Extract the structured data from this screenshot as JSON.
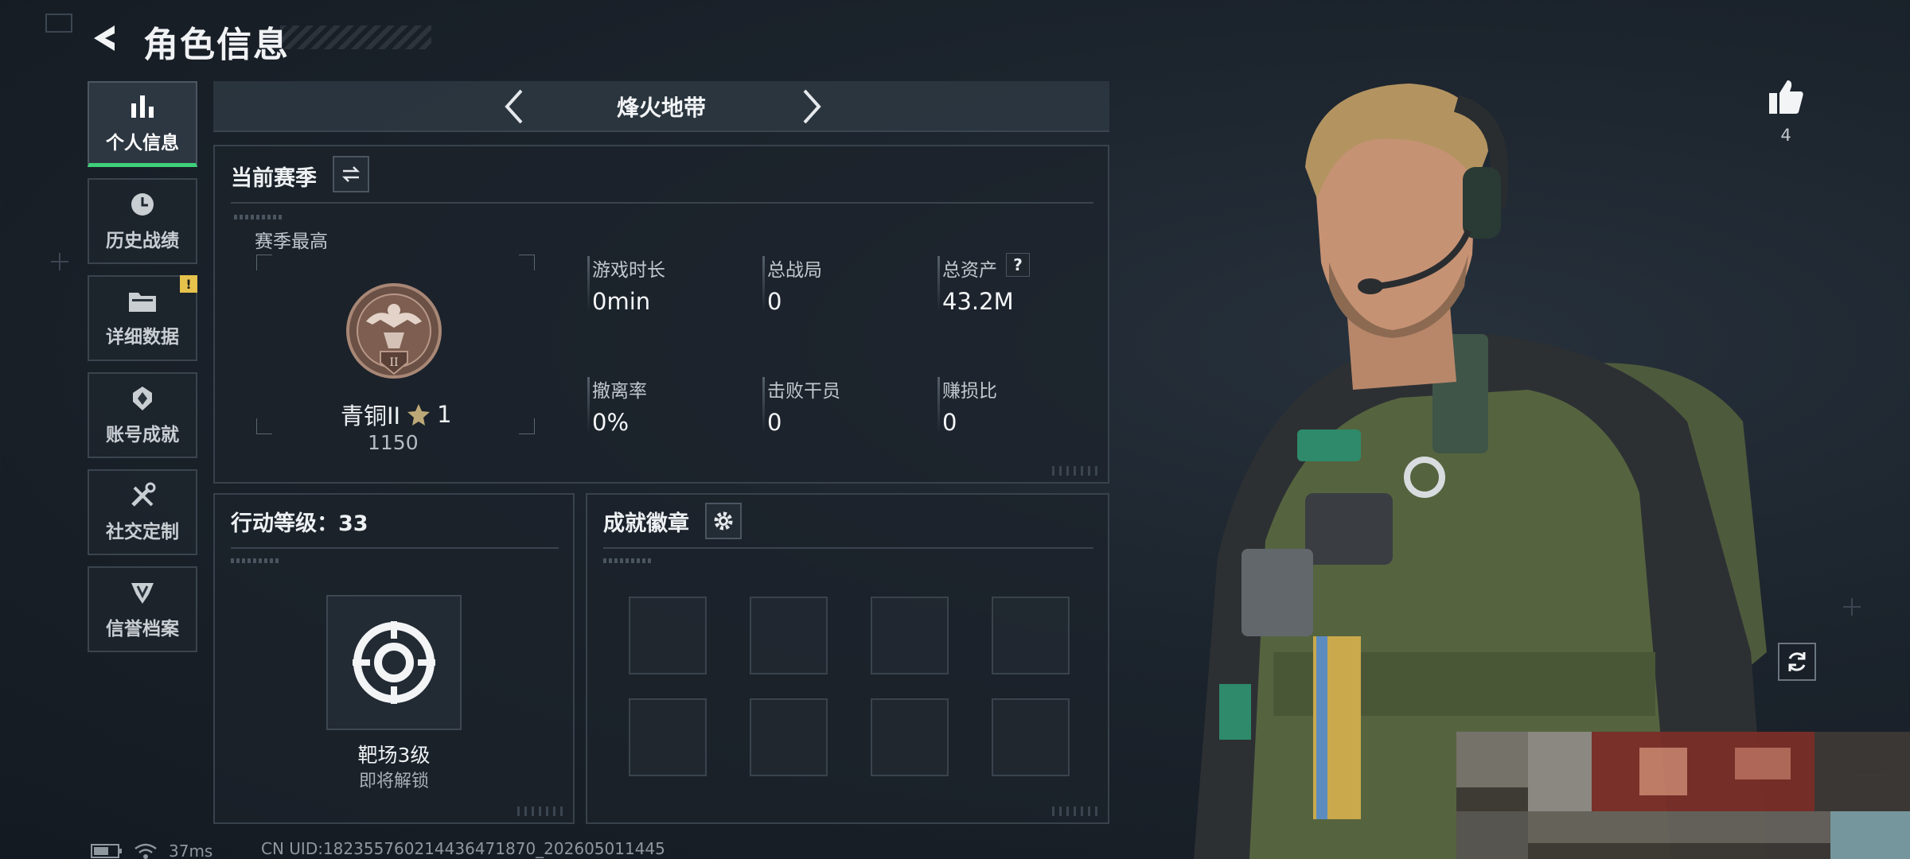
{
  "header": {
    "title": "角色信息"
  },
  "sidebar": {
    "items": [
      {
        "label": "个人信息",
        "icon": "bar-chart-icon",
        "active": true
      },
      {
        "label": "历史战绩",
        "icon": "history-clock-icon",
        "active": false
      },
      {
        "label": "详细数据",
        "icon": "folder-icon",
        "active": false,
        "badge": "!"
      },
      {
        "label": "账号成就",
        "icon": "achievement-icon",
        "active": false
      },
      {
        "label": "社交定制",
        "icon": "tools-icon",
        "active": false
      },
      {
        "label": "信誉档案",
        "icon": "reputation-icon",
        "active": false
      }
    ]
  },
  "mode": {
    "title": "烽火地带"
  },
  "season": {
    "title": "当前赛季",
    "best_label": "赛季最高",
    "rank_name": "青铜II",
    "rank_stars": "1",
    "rank_score": "1150",
    "stats": [
      {
        "label": "游戏时长",
        "value": "0min"
      },
      {
        "label": "总战局",
        "value": "0"
      },
      {
        "label": "总资产",
        "value": "43.2M",
        "help": "?"
      },
      {
        "label": "撤离率",
        "value": "0%"
      },
      {
        "label": "击败干员",
        "value": "0"
      },
      {
        "label": "赚损比",
        "value": "0"
      }
    ]
  },
  "action_level": {
    "title": "行动等级：33",
    "item_name": "靶场3级",
    "item_status": "即将解锁"
  },
  "achievements": {
    "title": "成就徽章",
    "slots": 8
  },
  "right": {
    "like_count": "4"
  },
  "footer": {
    "ping": "37ms",
    "uid": "CN UID:18235576021443647187​0_202605011445"
  },
  "colors": {
    "accent_green": "#3fd07a",
    "badge_yellow": "#e6c24c",
    "bronze": "#8a6a58"
  }
}
